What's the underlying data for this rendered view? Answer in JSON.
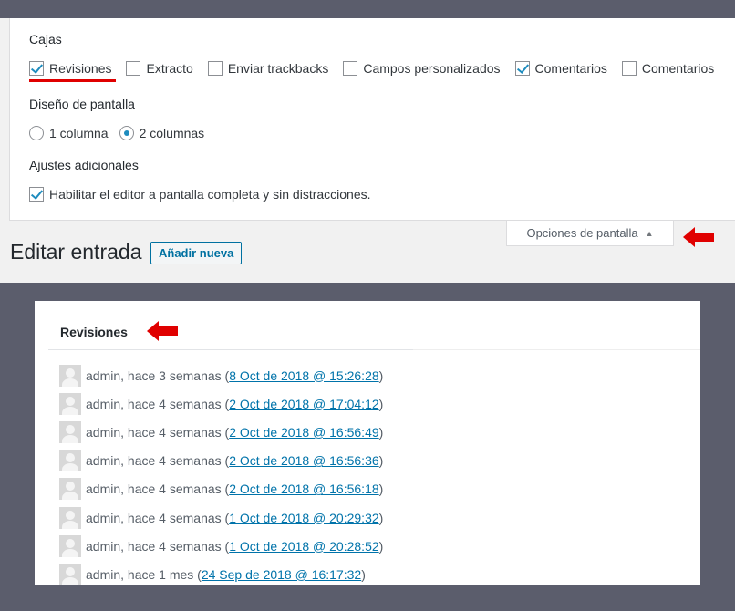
{
  "screen_options": {
    "boxes_heading": "Cajas",
    "boxes": [
      {
        "label": "Revisiones",
        "checked": true
      },
      {
        "label": "Extracto",
        "checked": false
      },
      {
        "label": "Enviar trackbacks",
        "checked": false
      },
      {
        "label": "Campos personalizados",
        "checked": false
      },
      {
        "label": "Comentarios",
        "checked": true
      },
      {
        "label": "Comentarios",
        "checked": false
      }
    ],
    "layout_heading": "Diseño de pantalla",
    "layout_options": [
      {
        "label": "1 columna",
        "selected": false
      },
      {
        "label": "2 columnas",
        "selected": true
      }
    ],
    "extra_heading": "Ajustes adicionales",
    "extra_option": {
      "label": "Habilitar el editor a pantalla completa y sin distracciones.",
      "checked": true
    },
    "tab_label": "Opciones de pantalla",
    "tab_icon": "triangle-up-icon"
  },
  "page": {
    "title": "Editar entrada",
    "add_new_label": "Añadir nueva"
  },
  "revisions": {
    "title": "Revisiones",
    "items": [
      {
        "author": "admin, hace 3 semanas (",
        "date": "8 Oct de 2018 @ 15:26:28",
        "close": ")"
      },
      {
        "author": "admin, hace 4 semanas (",
        "date": "2 Oct de 2018 @ 17:04:12",
        "close": ")"
      },
      {
        "author": "admin, hace 4 semanas (",
        "date": "2 Oct de 2018 @ 16:56:49",
        "close": ")"
      },
      {
        "author": "admin, hace 4 semanas (",
        "date": "2 Oct de 2018 @ 16:56:36",
        "close": ")"
      },
      {
        "author": "admin, hace 4 semanas (",
        "date": "2 Oct de 2018 @ 16:56:18",
        "close": ")"
      },
      {
        "author": "admin, hace 4 semanas (",
        "date": "1 Oct de 2018 @ 20:29:32",
        "close": ")"
      },
      {
        "author": "admin, hace 4 semanas (",
        "date": "1 Oct de 2018 @ 20:28:52",
        "close": ")"
      },
      {
        "author": "admin, hace 1 mes (",
        "date": "24 Sep de 2018 @ 16:17:32",
        "close": ")"
      }
    ]
  },
  "colors": {
    "accent": "#1e8cbe",
    "link": "#0073aa",
    "annotation_red": "#e00000",
    "backdrop": "#5b5d6c"
  }
}
